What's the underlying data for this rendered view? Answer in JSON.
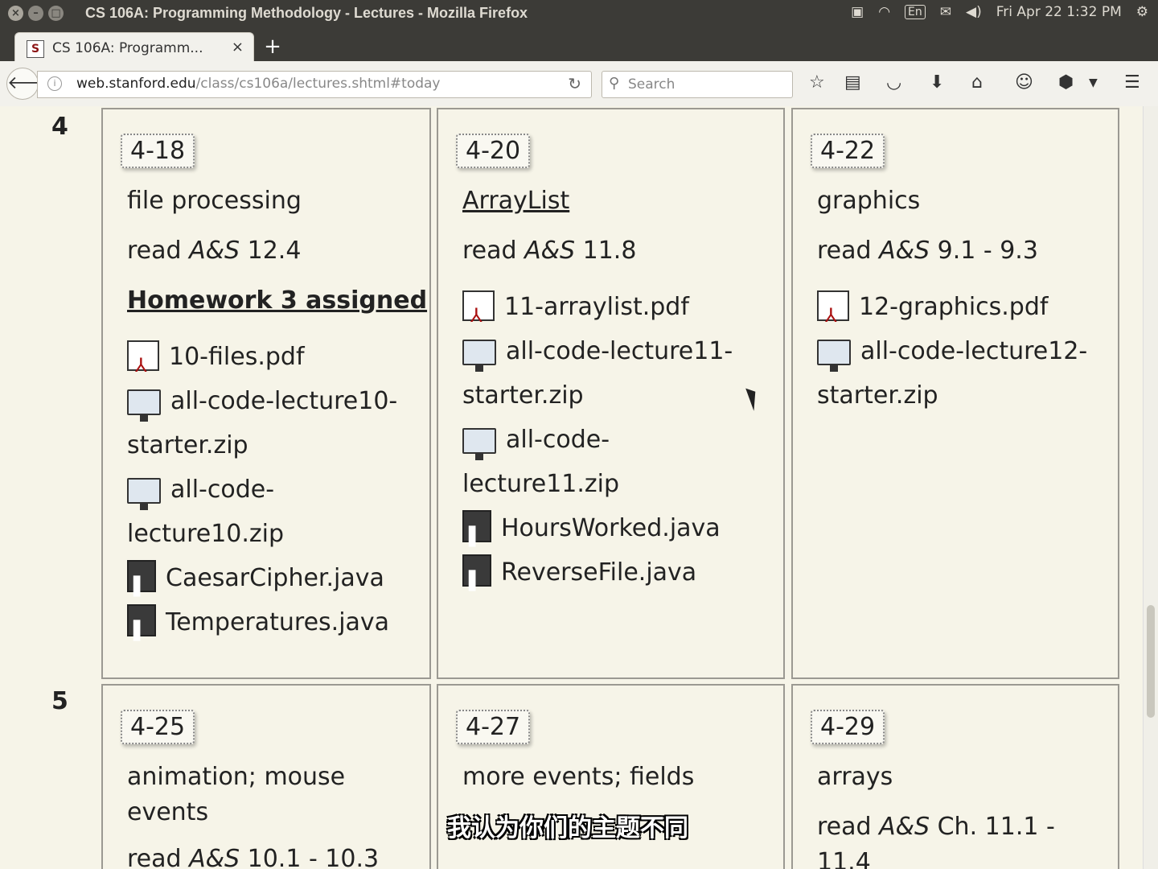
{
  "window": {
    "title": "CS 106A: Programming Methodology - Lectures - Mozilla Firefox",
    "controls": [
      "×",
      "–",
      "□"
    ]
  },
  "tray": {
    "keyboard": "En",
    "datetime": "Fri Apr 22  1:32 PM"
  },
  "tab": {
    "label": "CS 106A: Programm...",
    "favicon": "S",
    "close": "×",
    "newtab": "+"
  },
  "navbar": {
    "url_domain": "web.stanford.edu",
    "url_path": "/class/cs106a/lectures.shtml#today",
    "search_placeholder": "Search",
    "tools": [
      "star-icon",
      "reader-icon",
      "pocket-icon",
      "download-icon",
      "home-icon",
      "chat-icon",
      "adblock-icon",
      "dropdown-icon",
      "menu-icon"
    ]
  },
  "weeks": [
    {
      "number": "4",
      "days": [
        {
          "date": "4-18",
          "topic": "file processing",
          "topic_link": false,
          "read_prefix": "read ",
          "read_book": "A&S",
          "read_section": " 12.4",
          "homework": "Homework 3 assigned",
          "files": [
            {
              "type": "pdf",
              "name": "10-files.pdf"
            },
            {
              "type": "zip",
              "name": "all-code-lecture10-"
            },
            {
              "type": "cont",
              "name": "starter.zip"
            },
            {
              "type": "zip",
              "name": "all-code-"
            },
            {
              "type": "cont",
              "name": "lecture10.zip"
            },
            {
              "type": "java",
              "name": "CaesarCipher.java"
            },
            {
              "type": "java",
              "name": "Temperatures.java"
            }
          ]
        },
        {
          "date": "4-20",
          "topic": "ArrayList",
          "topic_link": true,
          "read_prefix": "read ",
          "read_book": "A&S",
          "read_section": " 11.8",
          "homework": "",
          "files": [
            {
              "type": "pdf",
              "name": "11-arraylist.pdf"
            },
            {
              "type": "zip",
              "name": "all-code-lecture11-"
            },
            {
              "type": "cont",
              "name": "starter.zip"
            },
            {
              "type": "zip",
              "name": "all-code-"
            },
            {
              "type": "cont",
              "name": "lecture11.zip"
            },
            {
              "type": "java",
              "name": "HoursWorked.java"
            },
            {
              "type": "java",
              "name": "ReverseFile.java"
            }
          ]
        },
        {
          "date": "4-22",
          "topic": "graphics",
          "topic_link": false,
          "read_prefix": "read ",
          "read_book": "A&S",
          "read_section": " 9.1 - 9.3",
          "homework": "",
          "files": [
            {
              "type": "pdf",
              "name": "12-graphics.pdf"
            },
            {
              "type": "zip",
              "name": "all-code-lecture12-"
            },
            {
              "type": "cont",
              "name": "starter.zip"
            }
          ]
        }
      ]
    },
    {
      "number": "5",
      "days": [
        {
          "date": "4-25",
          "topic_line1": "animation; mouse",
          "topic_line2": "events",
          "read_prefix": "read ",
          "read_book": "A&S",
          "read_section": " 10.1 - 10.3"
        },
        {
          "date": "4-27",
          "topic_line1": "more events; fields"
        },
        {
          "date": "4-29",
          "topic_line1": "arrays",
          "read_prefix": "read ",
          "read_book": "A&S",
          "read_section": " Ch. 11.1 -",
          "read_line2": "11.4"
        }
      ]
    }
  ],
  "subtitle": "我认为你们的主题不同"
}
